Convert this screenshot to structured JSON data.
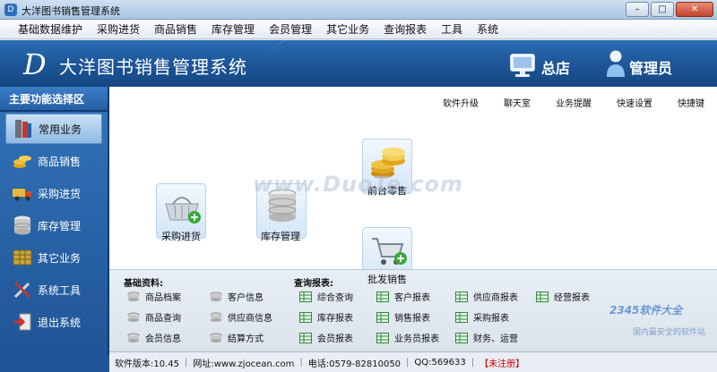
{
  "window": {
    "title": "大洋图书销售管理系统"
  },
  "menu": [
    "基础数据维护",
    "采购进货",
    "商品销售",
    "库存管理",
    "会员管理",
    "其它业务",
    "查询报表",
    "工具",
    "系统"
  ],
  "banner": {
    "logo": "D",
    "app_name": "大洋图书销售管理系统",
    "store": "总店",
    "user": "管理员"
  },
  "sidebar": {
    "header": "主要功能选择区",
    "items": [
      {
        "label": "常用业务",
        "icon": "books-icon",
        "active": true
      },
      {
        "label": "商品销售",
        "icon": "coins-icon",
        "active": false
      },
      {
        "label": "采购进货",
        "icon": "truck-icon",
        "active": false
      },
      {
        "label": "库存管理",
        "icon": "database-icon",
        "active": false
      },
      {
        "label": "其它业务",
        "icon": "grid-icon",
        "active": false
      },
      {
        "label": "系统工具",
        "icon": "tools-icon",
        "active": false
      },
      {
        "label": "退出系统",
        "icon": "exit-icon",
        "active": false
      }
    ]
  },
  "quicklinks": [
    "软件升级",
    "聊天室",
    "业务提醒",
    "快速设置",
    "快捷键"
  ],
  "tiles": {
    "retail": "前台零售",
    "purchase": "采购进货",
    "inventory": "库存管理",
    "wholesale": "批发销售"
  },
  "watermark": "www.DuoTe.com",
  "basic": {
    "title": "基础资料:",
    "col1": [
      "商品档案",
      "商品查询",
      "会员信息"
    ],
    "col2": [
      "客户信息",
      "供应商信息",
      "结算方式"
    ]
  },
  "reports": {
    "title": "查询报表:",
    "col1": [
      "综合查询",
      "库存报表",
      "会员报表"
    ],
    "col2": [
      "客户报表",
      "销售报表",
      "业务员报表"
    ],
    "col3": [
      "供应商报表",
      "采购报表",
      "财务、运营"
    ],
    "col4": [
      "经营报表"
    ]
  },
  "status": {
    "version": "软件版本:10.45",
    "site": "网址:www.zjocean.com",
    "phone": "电话:0579-82810050",
    "qq": "QQ:569633",
    "reg": "【未注册】"
  },
  "corner": {
    "brand": "2345软件大全",
    "site": "国内最安全的软件站"
  }
}
